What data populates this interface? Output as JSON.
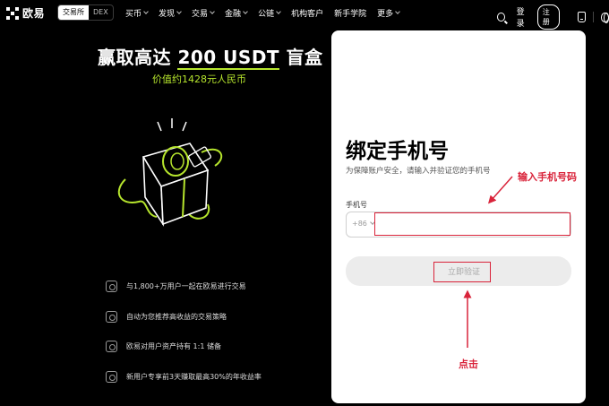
{
  "nav": {
    "logo_text": "欧易",
    "toggle": [
      "交易所",
      "DEX"
    ],
    "menu": [
      "买币",
      "发现",
      "交易",
      "金融",
      "公链",
      "机构客户",
      "新手学院",
      "更多"
    ],
    "menu_has_chevron": [
      true,
      true,
      true,
      true,
      true,
      false,
      false,
      true
    ],
    "login": "登录",
    "register": "注册"
  },
  "promo": {
    "title_pre": "赢取高达 ",
    "title_highlight": "200 USDT",
    "title_post": " 盲盒",
    "subtitle": "价值约1428元人民币",
    "features": [
      "与1,800+万用户一起在欧易进行交易",
      "自动为您推荐高收益的交易策略",
      "欧易对用户资产持有 1:1 储备",
      "新用户专享前3天赚取最高30%的年收益率"
    ]
  },
  "form": {
    "title": "绑定手机号",
    "subtitle": "为保障账户安全，请输入并验证您的手机号",
    "phone_label": "手机号",
    "country_code": "+86",
    "phone_value": "",
    "verify_button": "立即验证"
  },
  "annotations": {
    "input_hint": "输入手机号码",
    "click_hint": "点击",
    "color": "#d9233a"
  },
  "colors": {
    "accent": "#b6e52d",
    "background": "#000000",
    "card": "#ffffff"
  }
}
